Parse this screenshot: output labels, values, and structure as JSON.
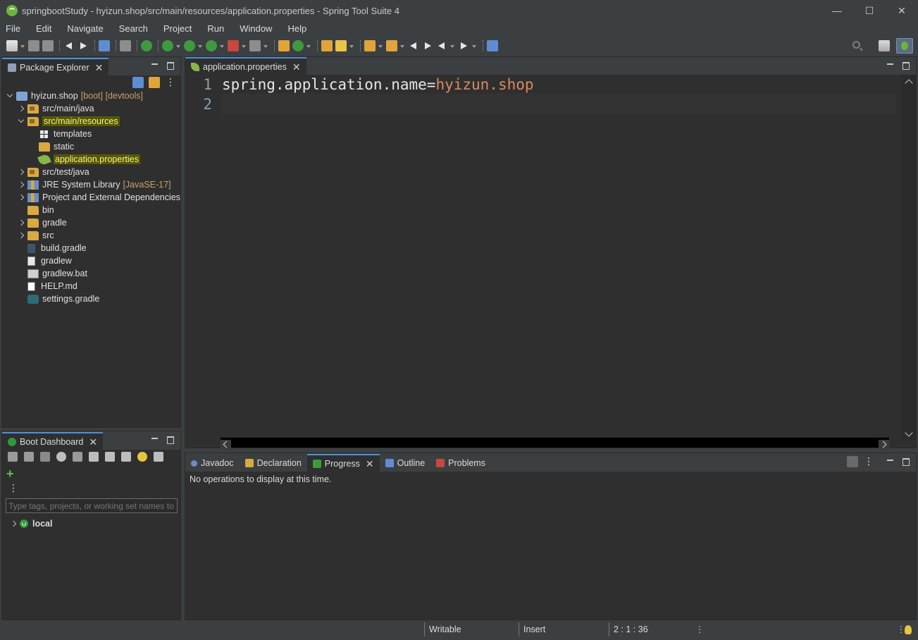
{
  "window": {
    "title": "springbootStudy - hyizun.shop/src/main/resources/application.properties - Spring Tool Suite 4",
    "minimize": "—",
    "maximize": "☐",
    "close": "✕"
  },
  "menu": [
    "File",
    "Edit",
    "Navigate",
    "Search",
    "Project",
    "Run",
    "Window",
    "Help"
  ],
  "package_explorer": {
    "tab_label": "Package Explorer",
    "tree": {
      "project": {
        "label": "hyizun.shop",
        "decorations": "[boot] [devtools]"
      },
      "src_main_java": "src/main/java",
      "src_main_resources": "src/main/resources",
      "templates": "templates",
      "static": "static",
      "application_properties": "application.properties",
      "src_test_java": "src/test/java",
      "jre": {
        "label": "JRE System Library",
        "decoration": "[JavaSE-17]"
      },
      "deps": "Project and External Dependencies",
      "bin": "bin",
      "gradle": "gradle",
      "src": "src",
      "build_gradle": "build.gradle",
      "gradlew": "gradlew",
      "gradlew_bat": "gradlew.bat",
      "help_md": "HELP.md",
      "settings_gradle": "settings.gradle"
    }
  },
  "boot_dashboard": {
    "tab_label": "Boot Dashboard",
    "filter_placeholder": "Type tags, projects, or working set names to",
    "local_label": "local"
  },
  "editor": {
    "tab_label": "application.properties",
    "lines": [
      {
        "num": "1",
        "key": "spring.application.name",
        "eq": "=",
        "value": "hyizun.shop"
      },
      {
        "num": "2",
        "key": "",
        "eq": "",
        "value": ""
      }
    ]
  },
  "bottom_panel": {
    "tabs": {
      "javadoc": "Javadoc",
      "declaration": "Declaration",
      "progress": "Progress",
      "outline": "Outline",
      "problems": "Problems"
    },
    "message": "No operations to display at this time."
  },
  "status_bar": {
    "writable": "Writable",
    "insert": "Insert",
    "position": "2 : 1 : 36"
  }
}
